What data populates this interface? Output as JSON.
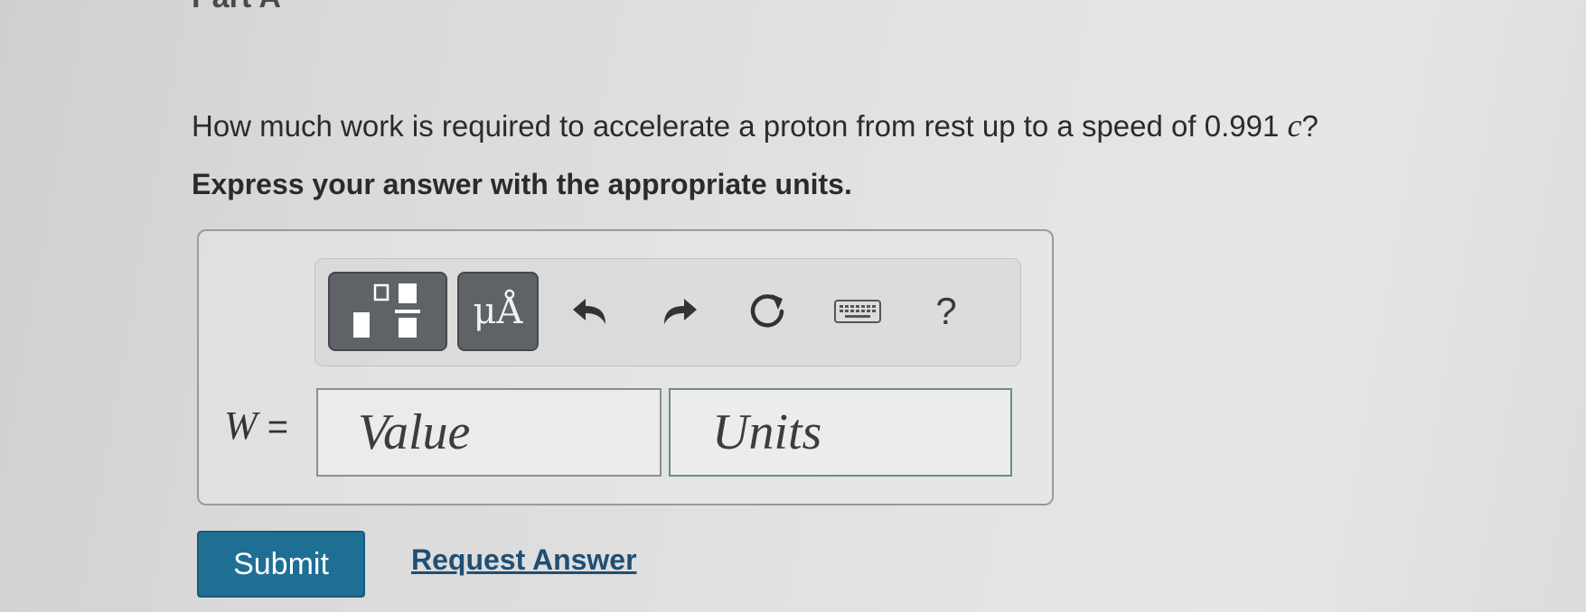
{
  "part": {
    "title": "Part A"
  },
  "question": {
    "text_before": "How much work is required to accelerate a proton from rest up to a speed of 0.991 ",
    "variable": "c",
    "text_after": "?"
  },
  "instruction": "Express your answer with the appropriate units.",
  "toolbar": {
    "units_label": "μÅ",
    "help_label": "?"
  },
  "answer": {
    "variable": "W",
    "equals": " =",
    "value_placeholder": "Value",
    "units_placeholder": "Units"
  },
  "actions": {
    "submit_label": "Submit",
    "request_label": "Request Answer"
  },
  "colors": {
    "submit": "#1f6f95",
    "toolbar_button": "#5f6368",
    "link": "#1f4f75"
  }
}
